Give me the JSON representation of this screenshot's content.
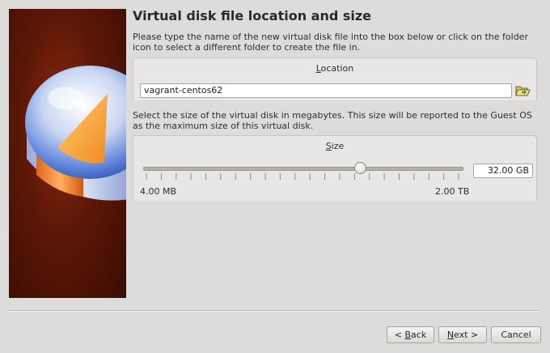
{
  "wizard": {
    "title": "Virtual disk file location and size",
    "location_description": "Please type the name of the new virtual disk file into the box below or click on the folder icon to select a different folder to create the file in.",
    "size_description": "Select the size of the virtual disk in megabytes. This size will be reported to the Guest OS as the maximum size of this virtual disk."
  },
  "location": {
    "group_title": "Location",
    "group_title_mnemonic": "L",
    "group_title_rest": "ocation",
    "value": "vagrant-centos62",
    "folder_icon": "folder-open-icon"
  },
  "size": {
    "group_title_mnemonic": "S",
    "group_title_rest": "ize",
    "value": "32.00 GB",
    "min_label": "4.00 MB",
    "max_label": "2.00 TB",
    "slider_fraction": 0.68
  },
  "buttons": {
    "back_prefix": "< ",
    "back_mnemonic": "B",
    "back_rest": "ack",
    "next_mnemonic": "N",
    "next_rest": "ext >",
    "cancel": "Cancel"
  },
  "colors": {
    "banner_bg": "#5c1706",
    "disk_blue": "#3f6fd6",
    "disk_orange": "#f59a2a"
  }
}
